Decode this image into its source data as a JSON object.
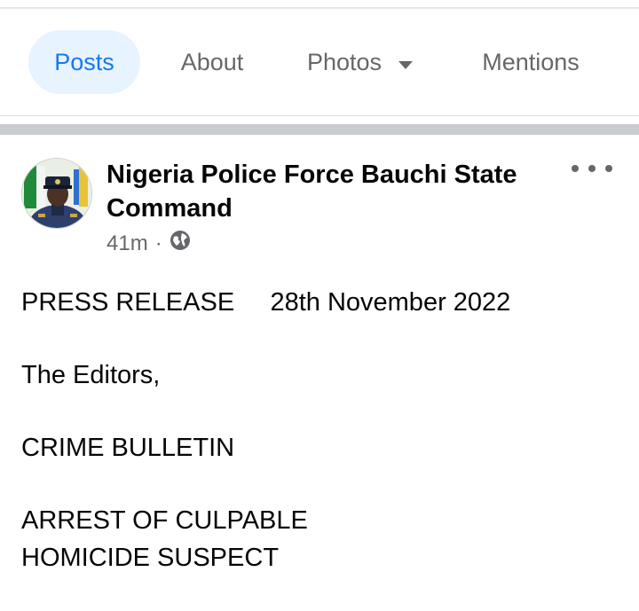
{
  "tabs": [
    {
      "label": "Posts",
      "active": true
    },
    {
      "label": "About",
      "active": false
    },
    {
      "label": "Photos",
      "active": false,
      "has_dropdown": true
    },
    {
      "label": "Mentions",
      "active": false
    }
  ],
  "post": {
    "author": "Nigeria Police Force Bauchi State Command",
    "time": "41m",
    "separator": "·",
    "audience_icon": "globe-icon",
    "more_icon": "more-options-icon",
    "body": {
      "heading": "PRESS RELEASE",
      "date": "28th November 2022",
      "salutation": "The Editors,",
      "bulletin": "CRIME BULLETIN",
      "title_line1": "ARREST OF CULPABLE",
      "title_line2": "HOMICIDE SUSPECT"
    }
  },
  "colors": {
    "accent": "#1877f2",
    "active_tab_bg": "#e7f3ff",
    "secondary_text": "#65676b",
    "divider": "#c9ccd1"
  }
}
